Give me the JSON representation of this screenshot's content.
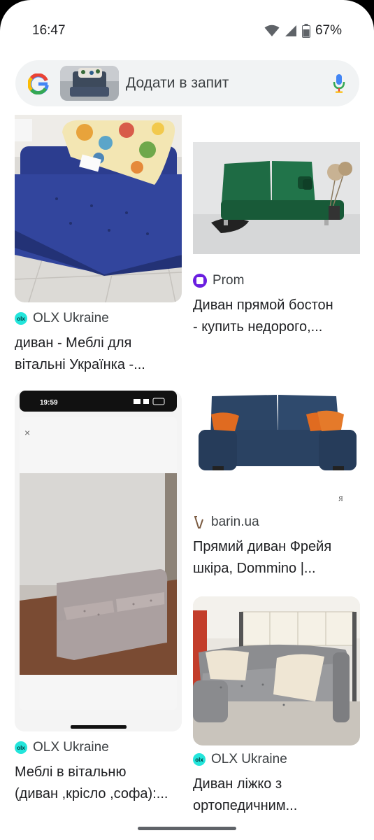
{
  "status_bar": {
    "time": "16:47",
    "battery": "67%"
  },
  "search": {
    "placeholder": "Додати в запит"
  },
  "results": [
    {
      "source": "OLX Ukraine",
      "title_line1": "диван - Меблі для",
      "title_line2": "вітальні Українка -..."
    },
    {
      "source": "Prom",
      "title_line1": "Диван прямой бостон",
      "title_line2": "- купить недорого,..."
    },
    {
      "source": "barin.ua",
      "title_line1": "Прямий диван Фрейя",
      "title_line2": "шкіра, Dommino |..."
    },
    {
      "source": "OLX Ukraine",
      "title_line1": "Меблі в вітальню",
      "title_line2": "(диван ,крісло ,софа):..."
    },
    {
      "source": "OLX Ukraine",
      "title_line1": "Диван ліжко з",
      "title_line2": "ортопедичним..."
    }
  ],
  "phone_screenshot": {
    "time": "19:59",
    "close": "×"
  },
  "colors": {
    "olx": "#23e5db",
    "prom": "#6a1ee0",
    "sofa_blue": "#2e3d8f",
    "sofa_green": "#1f6b44",
    "sofa_navy": "#2c4566"
  }
}
